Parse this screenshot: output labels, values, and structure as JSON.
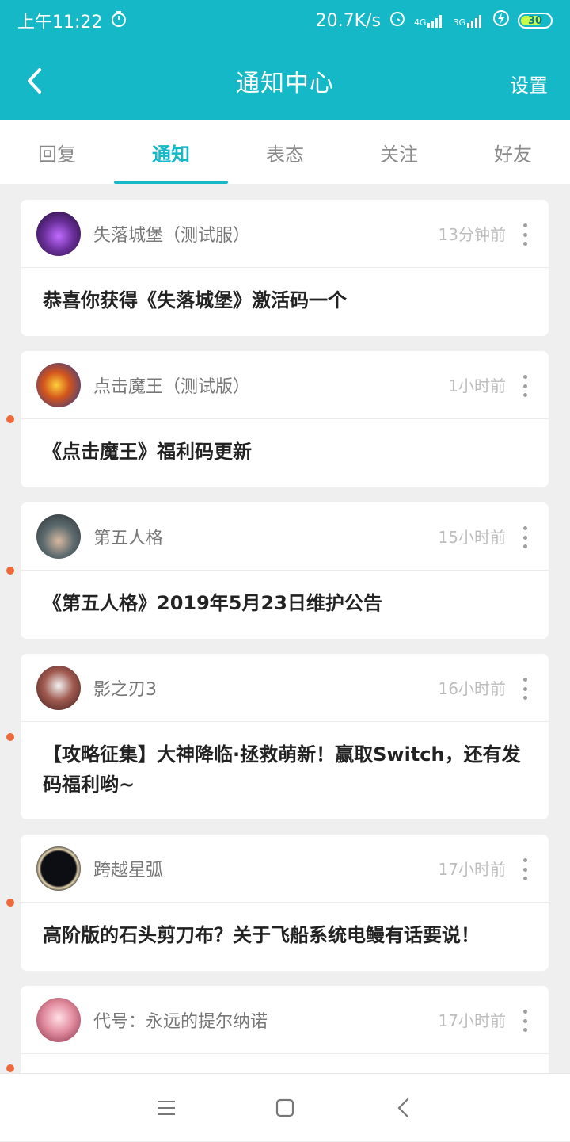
{
  "statusbar": {
    "time": "上午11:22",
    "net_speed": "20.7K/s",
    "signal_4g": "4G",
    "signal_3g": "3G",
    "battery": "30"
  },
  "appbar": {
    "title": "通知中心",
    "settings_label": "设置"
  },
  "tabs": [
    {
      "label": "回复"
    },
    {
      "label": "通知"
    },
    {
      "label": "表态"
    },
    {
      "label": "关注"
    },
    {
      "label": "好友"
    }
  ],
  "active_tab": "通知",
  "notifications": [
    {
      "name": "失落城堡（测试服）",
      "time": "13分钟前",
      "message": "恭喜你获得《失落城堡》激活码一个",
      "unread": false,
      "avatar_color": "#6a2f9a"
    },
    {
      "name": "点击魔王（测试版）",
      "time": "1小时前",
      "message": "《点击魔王》福利码更新",
      "unread": true,
      "avatar_color": "#c2501f"
    },
    {
      "name": "第五人格",
      "time": "15小时前",
      "message": "《第五人格》2019年5月23日维护公告",
      "unread": true,
      "avatar_color": "#5c6a6e"
    },
    {
      "name": "影之刃3",
      "time": "16小时前",
      "message": "【攻略征集】大神降临·拯救萌新！赢取Switch，还有发码福利哟~",
      "unread": true,
      "avatar_color": "#7d3a36"
    },
    {
      "name": "跨越星弧",
      "time": "17小时前",
      "message": "高阶版的石头剪刀布？关于飞船系统电鳗有话要说！",
      "unread": true,
      "avatar_color": "#1b1b24"
    },
    {
      "name": "代号：永远的提尔纳诺",
      "time": "17小时前",
      "message": "",
      "unread": true,
      "avatar_color": "#e28da0"
    }
  ],
  "colors": {
    "accent": "#14b8c6",
    "unread_dot": "#ee6a3a"
  },
  "icons": {
    "back": "chevron-left-icon",
    "more": "more-vertical-icon",
    "nav_menu": "menu-icon",
    "nav_home": "square-icon",
    "nav_back": "chevron-left-icon"
  }
}
